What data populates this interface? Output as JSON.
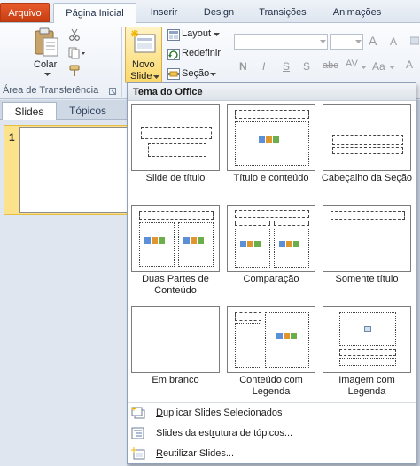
{
  "ribbon_tabs": [
    "Arquivo",
    "Página Inicial",
    "Inserir",
    "Design",
    "Transições",
    "Animações"
  ],
  "clipboard": {
    "paste_label": "Colar",
    "group_label": "Área de Transferência"
  },
  "slides_group": {
    "new_slide_line1": "Novo",
    "new_slide_line2": "Slide",
    "layout_label": "Layout",
    "reset_label": "Redefinir",
    "section_label": "Seção"
  },
  "font_group": {
    "bold": "N",
    "italic": "I",
    "underline": "S",
    "shadow": "S",
    "strike": "abc",
    "spacing": "AV",
    "case": "Aa",
    "grow": "A",
    "shrink": "A"
  },
  "left_pane": {
    "tabs": [
      "Slides",
      "Tópicos"
    ],
    "slide_number": "1"
  },
  "gallery": {
    "header": "Tema do Office",
    "layouts": [
      {
        "name": "Slide de título"
      },
      {
        "name": "Título e conteúdo"
      },
      {
        "name": "Cabeçalho da Seção"
      },
      {
        "name": "Duas Partes de Conteúdo"
      },
      {
        "name": "Comparação"
      },
      {
        "name": "Somente título"
      },
      {
        "name": "Em branco"
      },
      {
        "name": "Conteúdo com Legenda"
      },
      {
        "name": "Imagem com Legenda"
      }
    ],
    "menu": [
      {
        "key": "D",
        "rest": "uplicar Slides Selecionados"
      },
      {
        "pre": "Slides da est",
        "key": "r",
        "rest": "utura de tópicos..."
      },
      {
        "key": "R",
        "rest": "eutilizar Slides..."
      }
    ]
  },
  "colors": {
    "file_tab": "#d24a1b",
    "selection": "#fce38b",
    "accent_border": "#d7ae48"
  }
}
